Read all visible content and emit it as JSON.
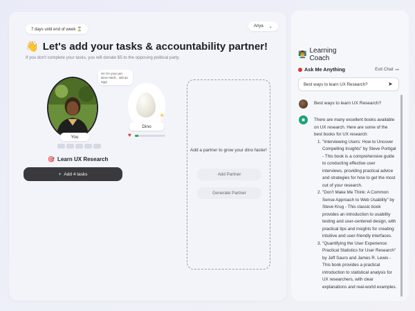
{
  "header": {
    "days_chip": "7 days until end of week ⌛",
    "user_name": "Ariya",
    "user_chevron": "⌄",
    "title_emoji": "👋",
    "title": "Let's add your tasks & accountability partner!",
    "subtitle": "If you don't complete your tasks, you will donate $5 to the opposing political party."
  },
  "user_card": {
    "label": "You",
    "goal_icon": "🎯",
    "goal": "Learn UX Research",
    "add_tasks_icon": "+",
    "add_tasks": "Add 4 tasks",
    "progress_dots": 5
  },
  "pet": {
    "speech": "Hi! I'm your pet Dino! Well... still an egg!",
    "name": "Dino",
    "sun_icon": "sun-icon",
    "heart_icon": "heart-icon",
    "health": 0.12,
    "colors": {
      "health": "#3f9e4a",
      "heart": "#d0342c"
    }
  },
  "partner": {
    "prompt": "Add a partner to grow your dino faster!",
    "add_button": "Add Partner",
    "generate_button": "Generate Partner"
  },
  "coach": {
    "title_emoji": "👨‍🏫",
    "title": "Learning Coach",
    "ask_label": "Ask Me Anything",
    "exit_label": "Exit Chat",
    "exit_icon": "↦",
    "input_value": "Best ways to learn UX Research?",
    "send_icon": "➤",
    "user_question": "Best ways to learn UX Research?",
    "bot_icon": "✺",
    "answer_intro": "There are many excellent books available on UX research. Here are some of the best books for UX research:",
    "answer_items": [
      "\"Interviewing Users: How to Uncover Compelling Insights\" by Steve Portigal - This book is a comprehensive guide to conducting effective user interviews, providing practical advice and strategies for how to get the most out of your research.",
      "\"Don't Make Me Think: A Common Sense Approach to Web Usability\" by Steve Krug - This classic book provides an introduction to usability testing and user-centered design, with practical tips and insights for creating intuitive and user-friendly interfaces.",
      "\"Quantifying the User Experience: Practical Statistics for User Research\" by Jeff Sauro and James R. Lewis - This book provides a practical introduction to statistical analysis for UX researchers, with clear explanations and real-world examples."
    ]
  }
}
